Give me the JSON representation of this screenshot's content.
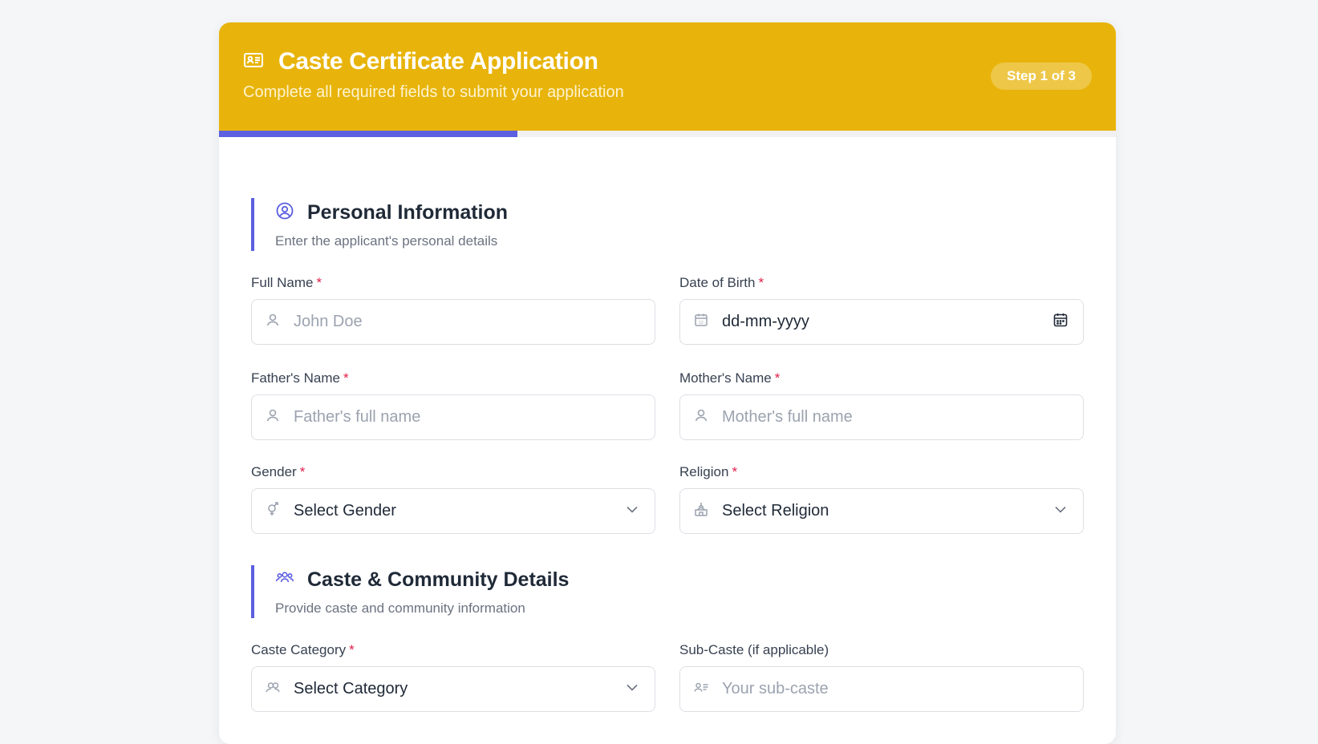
{
  "header": {
    "title": "Caste Certificate Application",
    "subtitle": "Complete all required fields to submit your application",
    "step_badge": "Step 1 of 3",
    "progress": 0.333,
    "icon": "id-card-icon",
    "bg_color": "#e8b40b"
  },
  "colors": {
    "accent": "#5b5fe0",
    "required": "#e11d48"
  },
  "sections": {
    "personal": {
      "title": "Personal Information",
      "subtitle": "Enter the applicant's personal details",
      "icon": "user-circle-icon"
    },
    "caste": {
      "title": "Caste & Community Details",
      "subtitle": "Provide caste and community information",
      "icon": "users-group-icon"
    }
  },
  "fields": {
    "full_name": {
      "label": "Full Name",
      "required": "*",
      "placeholder": "John Doe",
      "icon": "user-icon"
    },
    "dob": {
      "label": "Date of Birth",
      "required": "*",
      "value": "dd-mm-yyyy",
      "icon": "calendar-icon"
    },
    "father_name": {
      "label": "Father's Name",
      "required": "*",
      "placeholder": "Father's full name",
      "icon": "user-icon"
    },
    "mother_name": {
      "label": "Mother's Name",
      "required": "*",
      "placeholder": "Mother's full name",
      "icon": "user-icon"
    },
    "gender": {
      "label": "Gender",
      "required": "*",
      "value": "Select Gender",
      "icon": "gender-icon"
    },
    "religion": {
      "label": "Religion",
      "required": "*",
      "value": "Select Religion",
      "icon": "temple-icon"
    },
    "caste_category": {
      "label": "Caste Category",
      "required": "*",
      "value": "Select Category",
      "icon": "users-icon"
    },
    "sub_caste": {
      "label": "Sub-Caste (if applicable)",
      "placeholder": "Your sub-caste",
      "icon": "id-badge-icon"
    }
  }
}
